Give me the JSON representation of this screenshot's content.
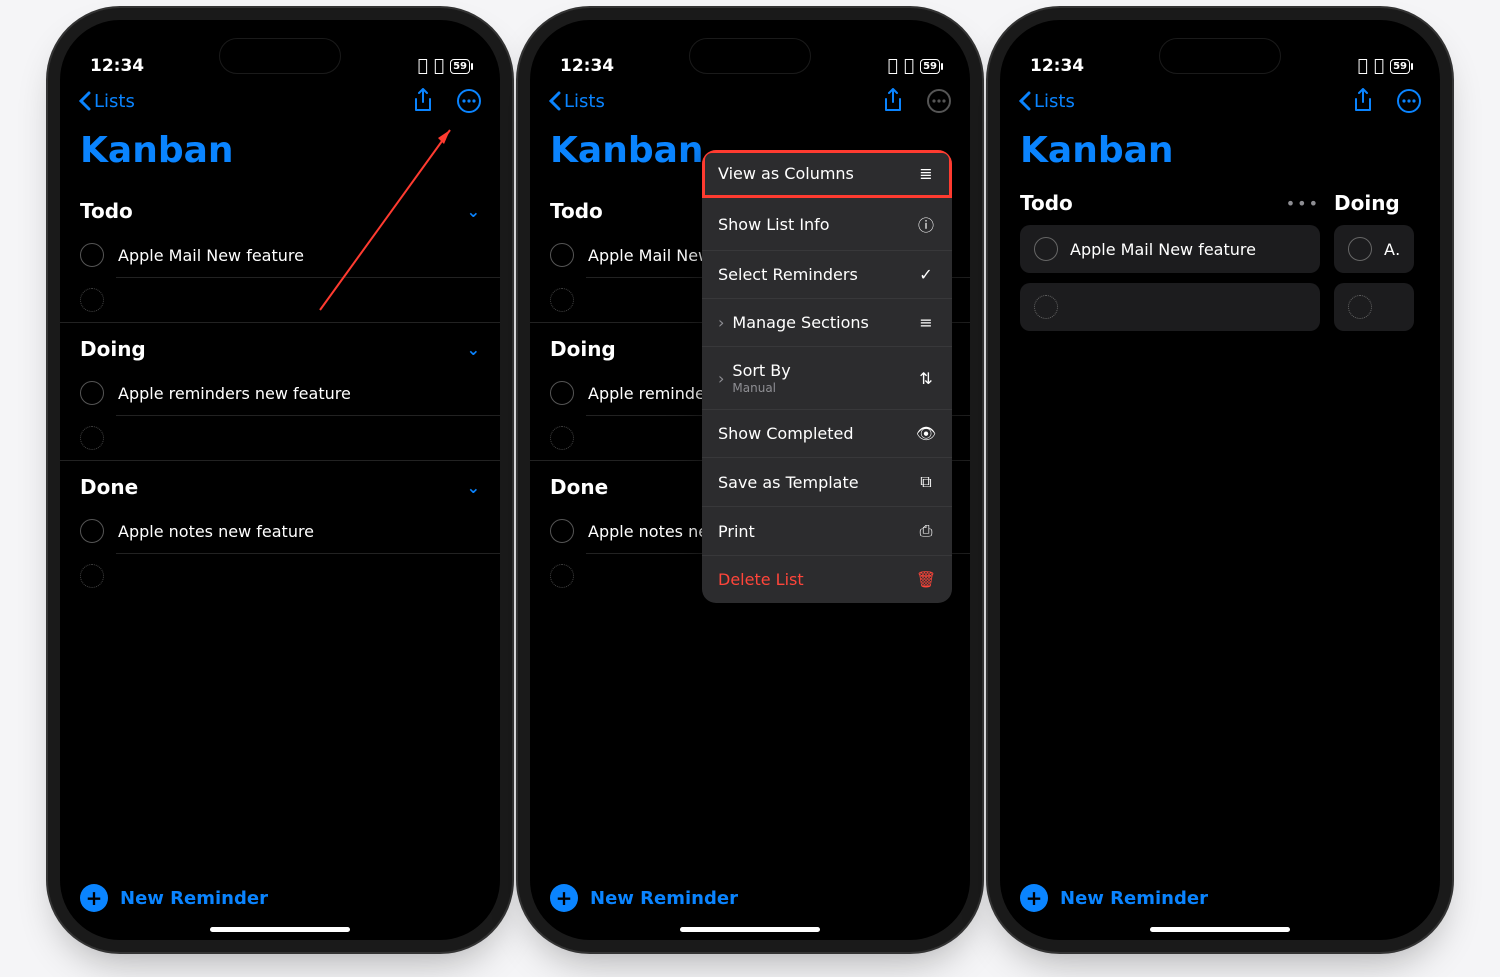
{
  "status": {
    "time": "12:34",
    "battery": "59"
  },
  "nav": {
    "back": "Lists"
  },
  "title": "Kanban",
  "newReminder": "New Reminder",
  "sections": [
    {
      "name": "Todo",
      "items": [
        "Apple Mail New feature"
      ]
    },
    {
      "name": "Doing",
      "items": [
        "Apple reminders new feature"
      ]
    },
    {
      "name": "Done",
      "items": [
        "Apple notes new feature"
      ]
    }
  ],
  "menu": {
    "viewAsColumns": "View as Columns",
    "showListInfo": "Show List Info",
    "selectReminders": "Select Reminders",
    "manageSections": "Manage Sections",
    "sortBy": "Sort By",
    "sortByValue": "Manual",
    "showCompleted": "Show Completed",
    "saveTemplate": "Save as Template",
    "print": "Print",
    "delete": "Delete List"
  },
  "columns": [
    {
      "name": "Todo",
      "items": [
        "Apple Mail New feature"
      ]
    },
    {
      "name": "Doing",
      "items": [
        "Appl"
      ]
    }
  ]
}
